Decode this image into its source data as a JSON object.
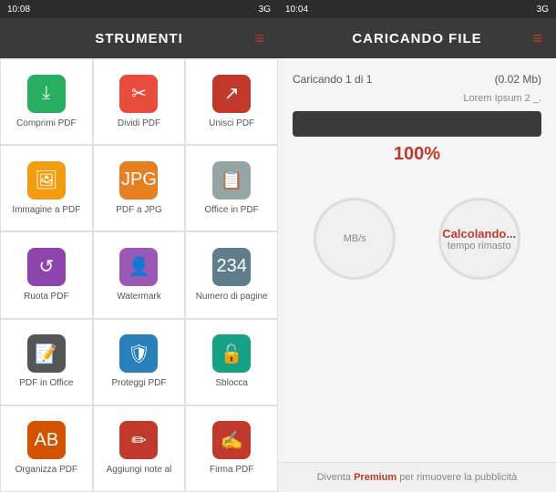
{
  "leftPanel": {
    "statusBar": {
      "time": "10:04",
      "signal": "3G"
    },
    "header": {
      "title": "CARICANDO FILE",
      "menuLabel": "≡"
    },
    "fileInfo": {
      "name": "Caricando 1 di 1",
      "subtitle": "Lorem Ipsum 2 _.",
      "size": "(0.02 Mb)"
    },
    "progress": {
      "percent": "100%",
      "barWidth": "100"
    },
    "circles": [
      {
        "label": "MB/s",
        "value": ""
      },
      {
        "label": "tempo rimasto",
        "value": "Calcolando..."
      }
    ],
    "promo": {
      "text": "Diventa ",
      "premiumLabel": "Premium",
      "suffix": " per rimuovere la pubblicità"
    }
  },
  "rightPanel": {
    "statusBar": {
      "time": "10:08",
      "signal": "3G"
    },
    "header": {
      "title": "STRUMENTI",
      "menuLabel": "≡"
    },
    "tools": [
      {
        "id": "comprimi-pdf",
        "label": "Comprimi PDF",
        "icon": "⤓",
        "color": "ic-green"
      },
      {
        "id": "dividi-pdf",
        "label": "Dividi PDF",
        "icon": "✂",
        "color": "ic-red"
      },
      {
        "id": "unisci-pdf",
        "label": "Unisci PDF",
        "icon": "↗",
        "color": "ic-dark-red"
      },
      {
        "id": "immagine-a-pdf",
        "label": "Immagine a PDF",
        "icon": "🖼",
        "color": "ic-yellow"
      },
      {
        "id": "pdf-a-jpg",
        "label": "PDF a JPG",
        "icon": "📄",
        "color": "ic-yellow2"
      },
      {
        "id": "office-in-pdf",
        "label": "Office in PDF",
        "icon": "📋",
        "color": "ic-gray"
      },
      {
        "id": "ruota-pdf",
        "label": "Ruota PDF",
        "icon": "↺",
        "color": "ic-purple"
      },
      {
        "id": "watermark",
        "label": "Watermark",
        "icon": "👤",
        "color": "ic-purple2"
      },
      {
        "id": "numero-di-pagine",
        "label": "Numero di pagine",
        "icon": "#",
        "color": "ic-blue-gray"
      },
      {
        "id": "pdf-in-office",
        "label": "PDF in Office",
        "icon": "📝",
        "color": "ic-dark-gray"
      },
      {
        "id": "proteggi-pdf",
        "label": "Proteggi PDF",
        "icon": "🛡",
        "color": "ic-blue"
      },
      {
        "id": "sblocca",
        "label": "Sblocca",
        "icon": "🔓",
        "color": "ic-teal"
      },
      {
        "id": "organizza-pdf",
        "label": "Organizza PDF",
        "icon": "☰",
        "color": "ic-orange-red"
      },
      {
        "id": "aggiungi-note",
        "label": "Aggiungi note al",
        "icon": "✏",
        "color": "ic-pink"
      },
      {
        "id": "firma-pdf",
        "label": "Firma PDF",
        "icon": "✍",
        "color": "ic-dark-red"
      }
    ]
  }
}
